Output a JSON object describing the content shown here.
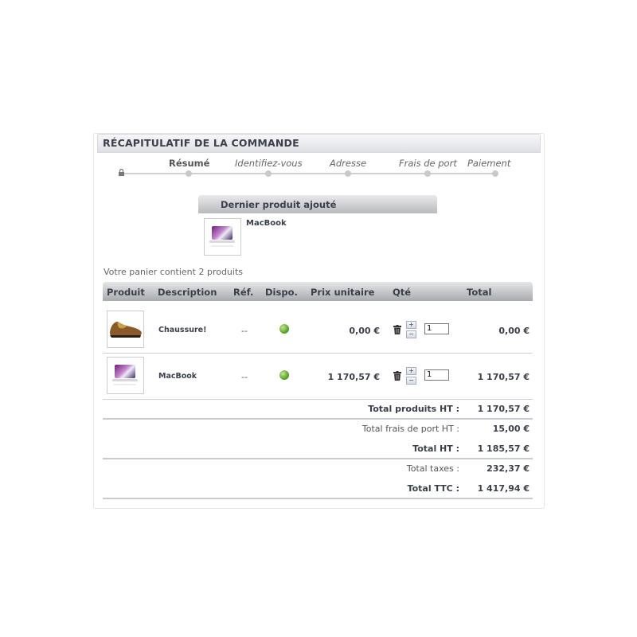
{
  "panel": {
    "title": "RÉCAPITULATIF DE LA COMMANDE"
  },
  "steps": [
    "Résumé",
    "Identifiez-vous",
    "Adresse",
    "Frais de port",
    "Paiement"
  ],
  "last_added": {
    "heading": "Dernier produit ajouté",
    "product_name": "MacBook"
  },
  "cart_summary": "Votre panier contient 2 produits",
  "table": {
    "headers": [
      "Produit",
      "Description",
      "Réf.",
      "Dispo.",
      "Prix unitaire",
      "Qté",
      "Total"
    ],
    "rows": [
      {
        "image": "shoe-image",
        "description": "Chaussure!",
        "ref": "--",
        "availability": "in-stock",
        "unit_price": "0,00 €",
        "qty": "1",
        "total": "0,00 €"
      },
      {
        "image": "macbook-image",
        "description": "MacBook",
        "ref": "--",
        "availability": "in-stock",
        "unit_price": "1 170,57 €",
        "qty": "1",
        "total": "1 170,57 €"
      }
    ],
    "qty_plus": "+",
    "qty_minus": "−"
  },
  "totals": {
    "products_ht_label": "Total produits HT :",
    "products_ht": "1 170,57 €",
    "shipping_ht_label": "Total frais de port HT :",
    "shipping_ht": "15,00 €",
    "total_ht_label": "Total HT :",
    "total_ht": "1 185,57 €",
    "taxes_label": "Total taxes :",
    "taxes": "232,37 €",
    "ttc_label": "Total TTC :",
    "ttc": "1 417,94 €"
  },
  "colors": {
    "in_stock": "#5ea72a",
    "header_text": "#3a3f4a"
  }
}
